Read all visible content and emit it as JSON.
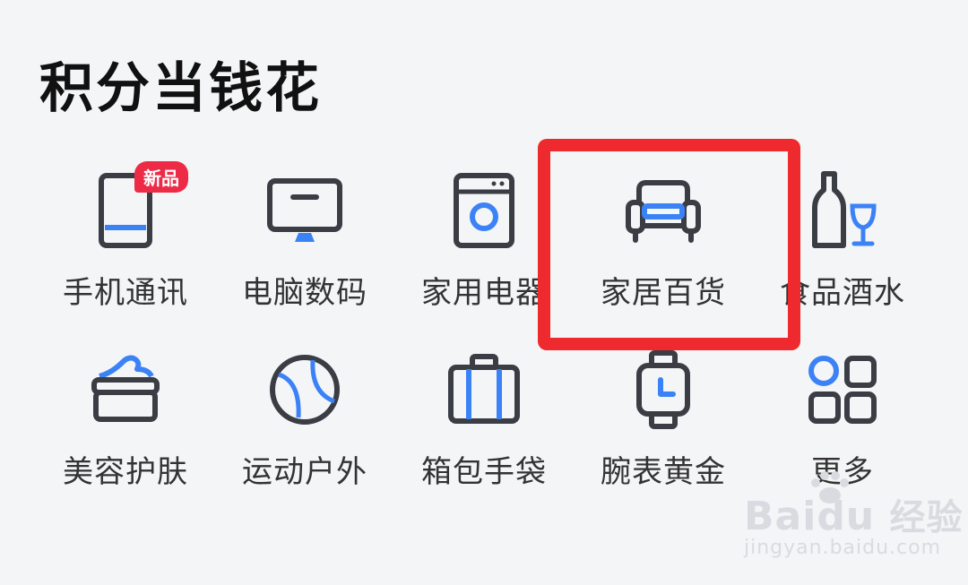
{
  "header": {
    "title": "积分当钱花"
  },
  "categories": [
    {
      "label": "手机通讯",
      "icon": "phone-icon",
      "badge": "新品"
    },
    {
      "label": "电脑数码",
      "icon": "computer-monitor-icon"
    },
    {
      "label": "家用电器",
      "icon": "washing-machine-icon"
    },
    {
      "label": "家居百货",
      "icon": "sofa-icon"
    },
    {
      "label": "食品酒水",
      "icon": "wine-bottle-glass-icon"
    },
    {
      "label": "美容护肤",
      "icon": "cream-jar-icon"
    },
    {
      "label": "运动户外",
      "icon": "tennis-ball-icon"
    },
    {
      "label": "箱包手袋",
      "icon": "suitcase-icon"
    },
    {
      "label": "腕表黄金",
      "icon": "wristwatch-icon"
    },
    {
      "label": "更多",
      "icon": "grid-more-icon"
    }
  ],
  "watermark": {
    "brand": "Bai",
    "brand_suffix": "du",
    "brand_cn": "经验",
    "url": "jingyan.baidu.com"
  },
  "colors": {
    "accent_blue": "#3b82f6",
    "icon_dark": "#3a3d44",
    "badge_red": "#ee2b47",
    "highlight_red": "#ee2a2e",
    "background": "#f4f5f7"
  }
}
